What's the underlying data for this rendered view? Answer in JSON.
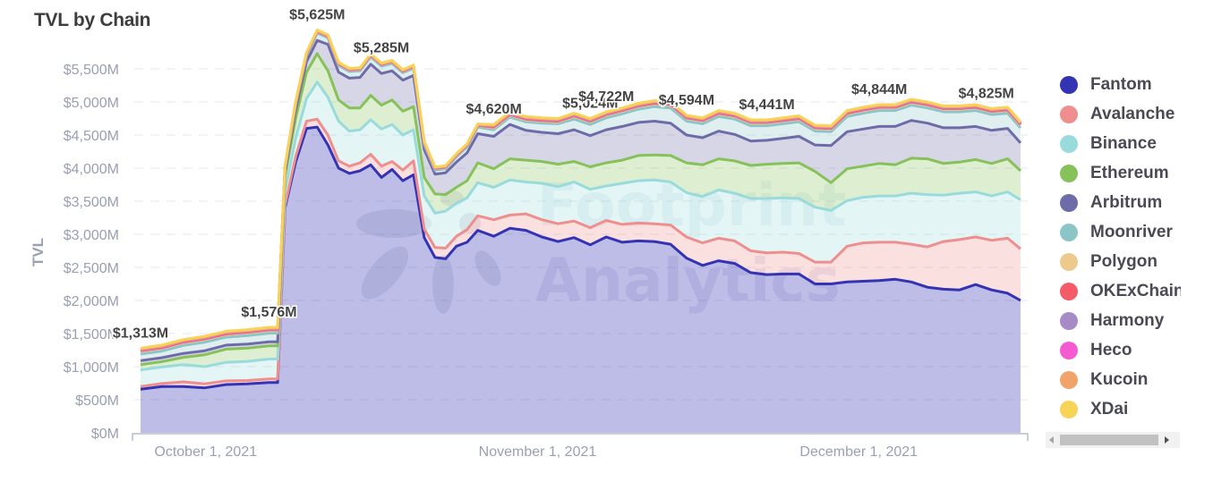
{
  "title": "TVL by Chain",
  "chart_data": {
    "type": "area",
    "stacked": true,
    "title": "TVL by Chain",
    "xlabel": "",
    "ylabel": "TVL",
    "ylim": [
      0,
      5500
    ],
    "yticks": [
      "$0M",
      "$500M",
      "$1,000M",
      "$1,500M",
      "$2,000M",
      "$2,500M",
      "$3,000M",
      "$3,500M",
      "$4,000M",
      "$4,500M",
      "$5,000M",
      "$5,500M"
    ],
    "ytick_values": [
      0,
      500,
      1000,
      1500,
      2000,
      2500,
      3000,
      3500,
      4000,
      4500,
      5000,
      5500
    ],
    "xticks": [
      {
        "label": "October 1, 2021",
        "day": 6
      },
      {
        "label": "November 1, 2021",
        "day": 37
      },
      {
        "label": "December 1, 2021",
        "day": 67
      }
    ],
    "x_start": "2021-09-25",
    "x_end": "2021-12-16",
    "x_days": [
      0,
      2,
      4,
      6,
      8,
      10,
      12,
      12.8,
      13.5,
      14.5,
      15.5,
      16.5,
      17.5,
      18.5,
      19.5,
      20.5,
      21.5,
      22.5,
      23.5,
      24.5,
      25.5,
      26.5,
      27.5,
      28.5,
      29.5,
      30.5,
      31.5,
      33,
      34.5,
      36,
      37.5,
      39,
      40.5,
      42,
      43.5,
      45,
      46.5,
      48,
      49.5,
      51,
      52.5,
      54,
      55.5,
      57,
      58.5,
      60,
      61.5,
      63,
      64.5,
      66,
      67.5,
      69,
      70.5,
      72,
      73.5,
      75,
      76.5,
      78,
      79.5,
      81,
      82.2
    ],
    "grid": true,
    "legend_position": "right",
    "series": [
      {
        "name": "Fantom",
        "color": "#3333b3",
        "values": [
          660,
          700,
          700,
          680,
          730,
          740,
          760,
          760,
          3400,
          4100,
          4600,
          4620,
          4350,
          4000,
          3920,
          3960,
          4050,
          3860,
          3980,
          3810,
          3900,
          2950,
          2650,
          2630,
          2820,
          2880,
          3060,
          2970,
          3090,
          3060,
          2960,
          2890,
          2950,
          2840,
          2960,
          2880,
          2900,
          2890,
          2850,
          2640,
          2530,
          2600,
          2560,
          2420,
          2390,
          2400,
          2400,
          2250,
          2250,
          2280,
          2290,
          2300,
          2320,
          2280,
          2200,
          2170,
          2160,
          2240,
          2160,
          2110,
          2000,
          2100
        ]
      },
      {
        "name": "Avalanche",
        "color": "#ef8e8e",
        "values": [
          40,
          45,
          70,
          60,
          55,
          50,
          55,
          55,
          40,
          80,
          110,
          120,
          150,
          110,
          110,
          120,
          160,
          170,
          120,
          160,
          210,
          130,
          150,
          160,
          150,
          190,
          220,
          250,
          200,
          250,
          260,
          270,
          250,
          260,
          250,
          270,
          270,
          270,
          290,
          320,
          340,
          340,
          340,
          330,
          330,
          330,
          310,
          330,
          330,
          540,
          580,
          580,
          560,
          570,
          610,
          720,
          760,
          720,
          750,
          830,
          780,
          830
        ]
      },
      {
        "name": "Binance",
        "color": "#99dbdc",
        "values": [
          250,
          250,
          260,
          260,
          280,
          290,
          300,
          300,
          220,
          280,
          340,
          560,
          570,
          600,
          530,
          500,
          520,
          560,
          560,
          530,
          470,
          500,
          520,
          560,
          500,
          480,
          500,
          490,
          530,
          480,
          550,
          560,
          590,
          580,
          520,
          620,
          640,
          660,
          650,
          670,
          700,
          730,
          720,
          790,
          820,
          820,
          830,
          830,
          780,
          690,
          690,
          700,
          700,
          770,
          790,
          700,
          700,
          680,
          670,
          700,
          740,
          720
        ]
      },
      {
        "name": "Ethereum",
        "color": "#86c15a",
        "values": [
          80,
          80,
          110,
          180,
          200,
          200,
          200,
          200,
          220,
          300,
          400,
          430,
          400,
          320,
          350,
          330,
          370,
          360,
          370,
          360,
          350,
          280,
          290,
          250,
          240,
          260,
          300,
          280,
          320,
          330,
          330,
          340,
          310,
          340,
          350,
          350,
          380,
          380,
          400,
          450,
          480,
          470,
          490,
          500,
          520,
          520,
          540,
          540,
          420,
          480,
          470,
          490,
          470,
          530,
          540,
          480,
          470,
          490,
          490,
          500,
          440,
          500
        ]
      },
      {
        "name": "Arbitrum",
        "color": "#6e6ca8",
        "values": [
          60,
          60,
          60,
          60,
          60,
          60,
          60,
          60,
          60,
          130,
          160,
          200,
          400,
          420,
          450,
          460,
          470,
          480,
          440,
          470,
          470,
          420,
          300,
          330,
          380,
          420,
          440,
          490,
          520,
          450,
          440,
          460,
          480,
          470,
          500,
          510,
          500,
          510,
          490,
          420,
          410,
          420,
          400,
          370,
          360,
          380,
          400,
          400,
          560,
          560,
          560,
          560,
          580,
          570,
          540,
          540,
          520,
          500,
          500,
          460,
          420,
          420
        ]
      },
      {
        "name": "Moonriver",
        "color": "#8bc5c8",
        "values": [
          100,
          100,
          120,
          130,
          120,
          130,
          130,
          130,
          50,
          80,
          90,
          110,
          100,
          100,
          100,
          100,
          110,
          110,
          110,
          110,
          110,
          80,
          60,
          60,
          80,
          90,
          100,
          100,
          110,
          130,
          140,
          150,
          160,
          170,
          180,
          190,
          200,
          220,
          230,
          210,
          210,
          220,
          230,
          230,
          220,
          220,
          220,
          210,
          210,
          230,
          240,
          240,
          240,
          230,
          230,
          240,
          240,
          240,
          240,
          230,
          230,
          240
        ]
      },
      {
        "name": "Polygon",
        "color": "#eec98e",
        "values": [
          40,
          40,
          40,
          40,
          40,
          40,
          40,
          40,
          20,
          20,
          20,
          20,
          20,
          20,
          20,
          20,
          20,
          20,
          20,
          20,
          20,
          20,
          20,
          20,
          20,
          20,
          20,
          30,
          30,
          30,
          30,
          30,
          40,
          40,
          40,
          40,
          40,
          40,
          40,
          40,
          40,
          40,
          40,
          40,
          40,
          40,
          40,
          40,
          40,
          40,
          40,
          40,
          40,
          40,
          40,
          40,
          40,
          40,
          40,
          40,
          40,
          40
        ]
      },
      {
        "name": "OKExChain",
        "color": "#f45b69",
        "values": [
          10,
          10,
          10,
          10,
          10,
          10,
          10,
          10,
          5,
          5,
          5,
          5,
          5,
          5,
          5,
          5,
          5,
          5,
          5,
          5,
          5,
          5,
          5,
          5,
          5,
          5,
          5,
          10,
          10,
          10,
          10,
          10,
          10,
          10,
          10,
          10,
          10,
          10,
          10,
          10,
          10,
          10,
          10,
          10,
          10,
          10,
          10,
          10,
          10,
          10,
          10,
          10,
          10,
          10,
          10,
          10,
          10,
          10,
          10,
          10,
          10,
          10
        ]
      },
      {
        "name": "Harmony",
        "color": "#a78bc7",
        "values": [
          10,
          10,
          10,
          10,
          10,
          10,
          10,
          10,
          5,
          5,
          5,
          5,
          5,
          5,
          5,
          5,
          5,
          5,
          5,
          5,
          5,
          5,
          5,
          5,
          5,
          5,
          5,
          10,
          10,
          10,
          10,
          10,
          10,
          10,
          10,
          10,
          10,
          10,
          10,
          10,
          10,
          10,
          10,
          10,
          10,
          10,
          10,
          10,
          10,
          10,
          10,
          10,
          10,
          10,
          10,
          10,
          10,
          10,
          10,
          10,
          10,
          10
        ]
      },
      {
        "name": "Heco",
        "color": "#f45bd0",
        "values": [
          5,
          5,
          5,
          5,
          5,
          5,
          5,
          5,
          3,
          3,
          3,
          3,
          3,
          3,
          3,
          3,
          3,
          3,
          3,
          3,
          3,
          3,
          3,
          3,
          3,
          3,
          3,
          5,
          5,
          5,
          5,
          5,
          5,
          5,
          5,
          5,
          5,
          5,
          5,
          5,
          5,
          5,
          5,
          5,
          5,
          5,
          5,
          5,
          5,
          5,
          5,
          5,
          5,
          5,
          5,
          5,
          5,
          5,
          5,
          5,
          5,
          5
        ]
      },
      {
        "name": "Kucoin",
        "color": "#f0a46a",
        "values": [
          10,
          10,
          10,
          10,
          10,
          10,
          10,
          10,
          5,
          5,
          5,
          5,
          5,
          5,
          5,
          5,
          5,
          5,
          5,
          5,
          5,
          5,
          5,
          5,
          5,
          5,
          5,
          10,
          10,
          10,
          10,
          10,
          10,
          10,
          10,
          10,
          10,
          10,
          10,
          10,
          10,
          10,
          10,
          10,
          10,
          10,
          10,
          10,
          10,
          10,
          10,
          10,
          10,
          10,
          10,
          10,
          10,
          10,
          10,
          10,
          10,
          10
        ]
      },
      {
        "name": "XDai",
        "color": "#f7d358",
        "values": [
          15,
          15,
          15,
          15,
          15,
          15,
          15,
          15,
          10,
          10,
          10,
          10,
          10,
          10,
          10,
          10,
          10,
          10,
          10,
          10,
          10,
          10,
          10,
          10,
          10,
          10,
          10,
          15,
          15,
          15,
          15,
          15,
          15,
          15,
          15,
          15,
          15,
          15,
          15,
          15,
          15,
          15,
          15,
          15,
          15,
          15,
          15,
          15,
          15,
          15,
          15,
          15,
          15,
          15,
          15,
          15,
          15,
          15,
          15,
          15,
          15,
          15
        ]
      }
    ],
    "annotations": [
      {
        "text": "$1,313M",
        "day": 0
      },
      {
        "text": "$1,576M",
        "day": 12
      },
      {
        "text": "$5,625M",
        "day": 16.5
      },
      {
        "text": "$5,285M",
        "day": 22.5
      },
      {
        "text": "$4,620M",
        "day": 33
      },
      {
        "text": "$5,024M",
        "day": 42
      },
      {
        "text": "$4,722M",
        "day": 43.5
      },
      {
        "text": "$4,594M",
        "day": 51
      },
      {
        "text": "$4,441M",
        "day": 58.5
      },
      {
        "text": "$4,844M",
        "day": 69
      },
      {
        "text": "$4,825M",
        "day": 79
      }
    ],
    "watermark": [
      "Footprint",
      "Analytics"
    ]
  },
  "legend": {
    "items": [
      {
        "label": "Fantom",
        "color": "#3333b3"
      },
      {
        "label": "Avalanche",
        "color": "#ef8e8e"
      },
      {
        "label": "Binance",
        "color": "#99dbdc"
      },
      {
        "label": "Ethereum",
        "color": "#86c15a"
      },
      {
        "label": "Arbitrum",
        "color": "#6e6ca8"
      },
      {
        "label": "Moonriver",
        "color": "#8bc5c8"
      },
      {
        "label": "Polygon",
        "color": "#eec98e"
      },
      {
        "label": "OKExChain",
        "color": "#f45b69"
      },
      {
        "label": "Harmony",
        "color": "#a78bc7"
      },
      {
        "label": "Heco",
        "color": "#f45bd0"
      },
      {
        "label": "Kucoin",
        "color": "#f0a46a"
      },
      {
        "label": "XDai",
        "color": "#f7d358"
      }
    ]
  }
}
